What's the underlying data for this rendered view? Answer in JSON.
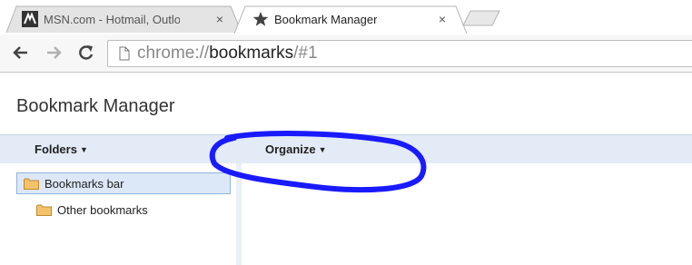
{
  "tabs": [
    {
      "title": "MSN.com - Hotmail, Outlo",
      "close_glyph": "×",
      "icon": "msn-icon",
      "active": false
    },
    {
      "title": "Bookmark Manager",
      "close_glyph": "×",
      "icon": "star-icon",
      "active": true
    },
    {
      "title": "",
      "icon": "new-tab",
      "active": false
    }
  ],
  "omnibox": {
    "scheme": "chrome://",
    "host": "bookmarks",
    "path": "/#1"
  },
  "page": {
    "title": "Bookmark Manager"
  },
  "menus": {
    "folders": "Folders",
    "organize": "Organize",
    "caret": "▼"
  },
  "tree": [
    {
      "label": "Bookmarks bar",
      "selected": true
    },
    {
      "label": "Other bookmarks",
      "selected": false
    }
  ],
  "colors": {
    "header_bg": "#e2ebf6",
    "selection_bg": "#dce8f8",
    "folder": "#f2c36b",
    "annotation_ring": "#1a1aff"
  }
}
